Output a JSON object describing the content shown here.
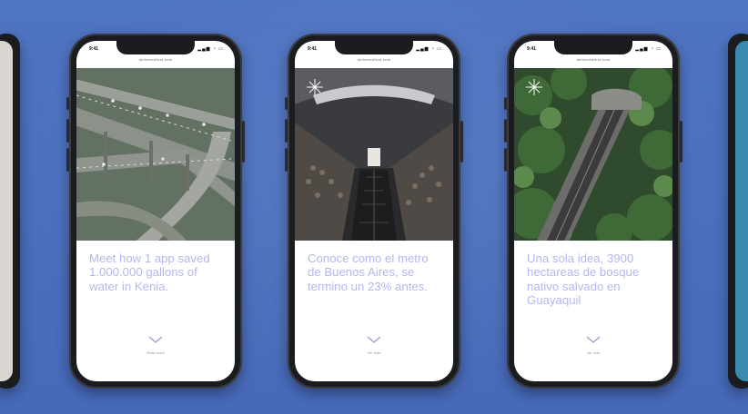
{
  "cards": [
    {
      "time": "9:41",
      "signal_icon": "signal-wifi-battery-icon",
      "url": "deliveredfirst.com",
      "photo_icon": "highway-interchange-photo",
      "caption": "Meet how 1 app saved 1.000.000 gallons of water in Kenia.",
      "more_icon": "chevron-down-icon",
      "more_label": "Read more"
    },
    {
      "time": "9:41",
      "signal_icon": "signal-wifi-battery-icon",
      "url": "deliveredfirst.com",
      "photo_icon": "subway-escalator-photo",
      "caption": "Conoce como el metro de Buenos Aires, se termino un 23% antes.",
      "more_icon": "chevron-down-icon",
      "more_label": "Ver más"
    },
    {
      "time": "9:41",
      "signal_icon": "signal-wifi-battery-icon",
      "url": "deliveredfirst.com",
      "photo_icon": "forest-funicular-photo",
      "caption": "Una sola idea, 3900 hectareas de bosque nativo salvado en Guayaquil",
      "more_icon": "chevron-down-icon",
      "more_label": "Ver más"
    }
  ],
  "colors": {
    "background": "#4a70bf",
    "caption": "#b4b7f0",
    "phone_frame": "#1b1c1f"
  }
}
